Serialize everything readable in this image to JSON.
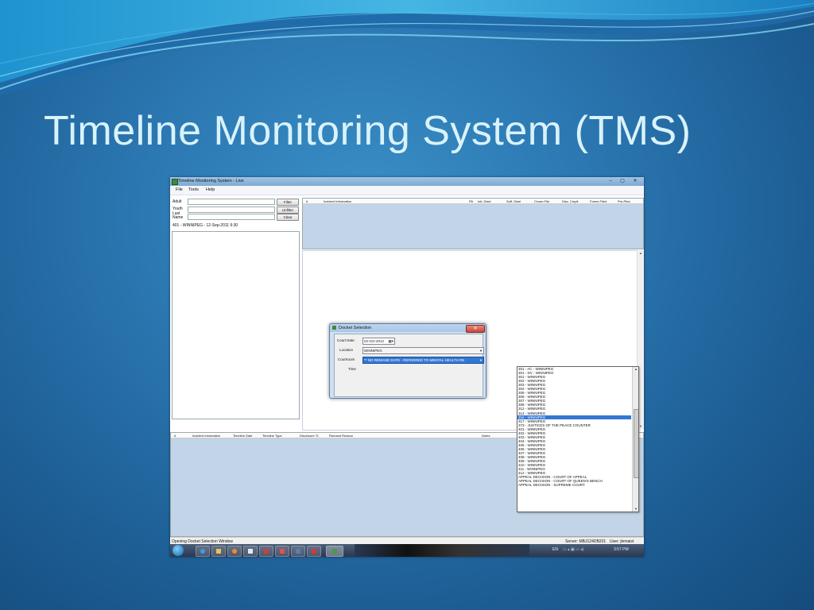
{
  "slide": {
    "title": "Timeline Monitoring System (TMS)"
  },
  "window": {
    "title": "Timeline Monitoring System - Live",
    "controls": {
      "minimize": "–",
      "maximize": "▢",
      "close": "✕"
    }
  },
  "menu": [
    "File",
    "Tools",
    "Help"
  ],
  "search": {
    "adult_label": "Adult",
    "youth_label": "Youth",
    "last_name_label": "Last Name",
    "filter_button": "Filter",
    "unfilter_button": "Unfilter",
    "clear_button": "Clear",
    "docket_info": "401 - WINNIPEG - 12-Sep-2011 9:30"
  },
  "top_grid": {
    "headers": [
      "#",
      "Incident Information",
      "PA",
      "Init. Disel",
      "Suff. Disel",
      "Crown File",
      "Disc. Cmplt",
      "Forms Filed",
      "Pre-Plea"
    ]
  },
  "bottom_grid": {
    "headers": [
      "#",
      "Incident Information",
      "Timeline Date",
      "Timeline Type",
      "Disclosure TL",
      "Remand Reason",
      "Notes"
    ]
  },
  "dialog": {
    "title": "Docket Selection",
    "close": "✕",
    "court_date_label": "Court Date",
    "court_date_value": "02-Oct-2012",
    "location_label": "Location",
    "location_value": "WINNIPEG",
    "courtroom_label": "Courtroom",
    "courtroom_value": "** NO REMAND DATE - REFERRED TO MENTAL HEALTH RE",
    "time_label": "Time"
  },
  "courtroom_options": [
    "301 - AC - WINNIPEG",
    "301 - DV - WINNIPEG",
    "301 - WINNIPEG",
    "302 - WINNIPEG",
    "303 - WINNIPEG",
    "304 - WINNIPEG",
    "305 - WINNIPEG",
    "306 - WINNIPEG",
    "307 - WINNIPEG",
    "308 - WINNIPEG",
    "312 - WINNIPEG",
    "314 - WINNIPEG",
    "316 - WINNIPEG",
    "317 - WINNIPEG",
    "373 - JUSTICES OF THE PEACE COUNTER",
    "401 - WINNIPEG",
    "402 - WINNIPEG",
    "403 - WINNIPEG",
    "404 - WINNIPEG",
    "405 - WINNIPEG",
    "406 - WINNIPEG",
    "407 - WINNIPEG",
    "408 - WINNIPEG",
    "409 - WINNIPEG",
    "410 - WINNIPEG",
    "411 - WINNIPEG",
    "412 - WINNIPEG",
    "APPEAL DECISION - COURT OF APPEAL",
    "APPEAL DECISION - COURT OF QUEEN'S BENCH",
    "APPEAL DECISION - SUPREME COURT"
  ],
  "selected_option_index": 12,
  "status": {
    "message": "Opening Docket Selection Window",
    "server": "Server: MBJ124DB201",
    "user": "User: jlemaist"
  },
  "taskbar": {
    "language": "EN",
    "clock": "3:57 PM",
    "icons": [
      "start-orb-icon",
      "ie-icon",
      "explorer-icon",
      "media-icon",
      "window-icon",
      "paint-icon",
      "app-icon",
      "tools-icon",
      "pdf-icon",
      "tms-icon"
    ]
  },
  "colors": {
    "accent": "#3377d6",
    "grid_bg": "#c2d4e8"
  }
}
